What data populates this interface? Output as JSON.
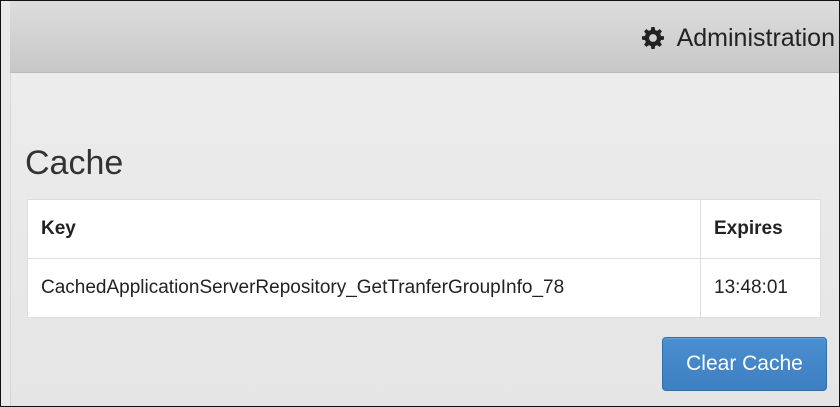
{
  "header": {
    "admin_icon": "gear-icon",
    "admin_label": "Administration"
  },
  "page": {
    "title": "Cache"
  },
  "table": {
    "headers": {
      "key": "Key",
      "expires": "Expires"
    },
    "rows": [
      {
        "key": "CachedApplicationServerRepository_GetTranferGroupInfo_78",
        "expires": "13:48:01"
      }
    ]
  },
  "actions": {
    "clear_cache_label": "Clear Cache"
  },
  "colors": {
    "primary_button": "#428bca",
    "header_gray": "#d0d0d0",
    "page_background": "#e9e9e9"
  }
}
